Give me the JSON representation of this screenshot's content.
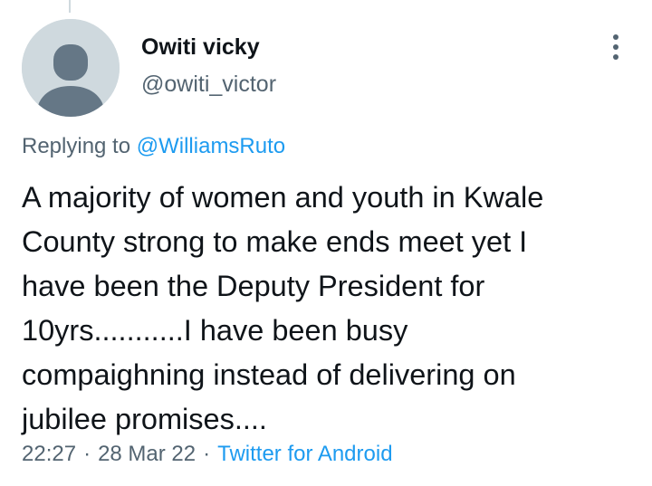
{
  "author": {
    "display_name": "Owiti vicky",
    "handle": "@owiti_victor"
  },
  "reply": {
    "prefix": "Replying to ",
    "mention": "@WilliamsRuto"
  },
  "tweet": {
    "lines": [
      "A majority of women and youth in Kwale",
      "County strong to make ends meet yet I",
      "have been the Deputy President for",
      "10yrs...........I have been busy",
      "compaighning instead of delivering on",
      "jubilee promises...."
    ]
  },
  "meta": {
    "time": "22:27",
    "separator": "·",
    "date": "28 Mar 22",
    "source": "Twitter for Android"
  },
  "icons": {
    "avatar": "default-avatar-icon",
    "more": "more-options-icon"
  },
  "colors": {
    "text": "#0f1419",
    "secondary": "#536471",
    "link": "#1d9bf0",
    "avatar_bg": "#cfd9de"
  }
}
